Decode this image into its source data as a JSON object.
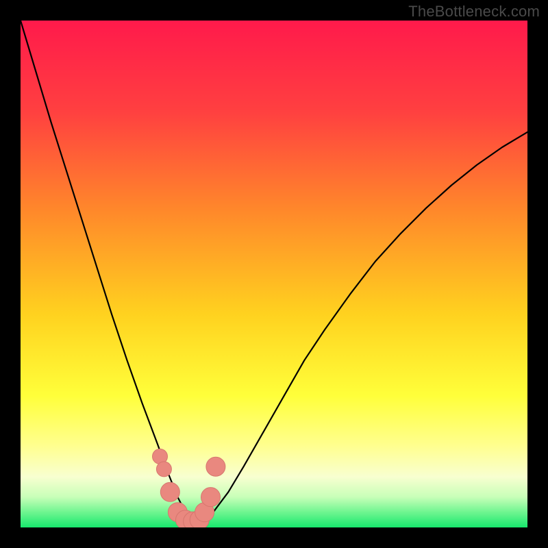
{
  "watermark": "TheBottleneck.com",
  "colors": {
    "frame": "#000000",
    "gradient_top": "#ff1a4b",
    "gradient_mid1": "#ff7a2a",
    "gradient_mid2": "#ffd21f",
    "gradient_low1": "#ffff55",
    "gradient_low2": "#f6ffb0",
    "gradient_bottom": "#17e86d",
    "curve": "#000000",
    "marker_fill": "#e9887f",
    "marker_stroke": "#d6766e"
  },
  "chart_data": {
    "type": "line",
    "title": "",
    "xlabel": "",
    "ylabel": "",
    "xlim": [
      0,
      100
    ],
    "ylim": [
      0,
      100
    ],
    "x": [
      0,
      3,
      6,
      9,
      12,
      15,
      18,
      21,
      24,
      27,
      29,
      30,
      31,
      32,
      33,
      34,
      35,
      36,
      38,
      41,
      44,
      48,
      52,
      56,
      60,
      65,
      70,
      75,
      80,
      85,
      90,
      95,
      100
    ],
    "values": [
      100,
      90,
      80,
      70.5,
      61,
      51.5,
      42,
      33,
      24.5,
      16.5,
      11,
      8.5,
      6,
      4,
      2.5,
      1.5,
      1,
      1.5,
      3,
      7,
      12,
      19,
      26,
      33,
      39,
      46,
      52.5,
      58,
      63,
      67.5,
      71.5,
      75,
      78
    ],
    "series": [
      {
        "name": "markers",
        "type": "scatter",
        "x": [
          27.5,
          28.3,
          29.5,
          31,
          32.5,
          34,
          35.3,
          36.3,
          37.5,
          38.5
        ],
        "y": [
          14,
          11.5,
          7,
          3,
          1.5,
          1.2,
          1.5,
          3,
          6,
          12
        ],
        "marker_size": [
          11,
          11,
          14,
          14,
          14,
          14,
          14,
          14,
          14,
          14
        ]
      }
    ]
  }
}
